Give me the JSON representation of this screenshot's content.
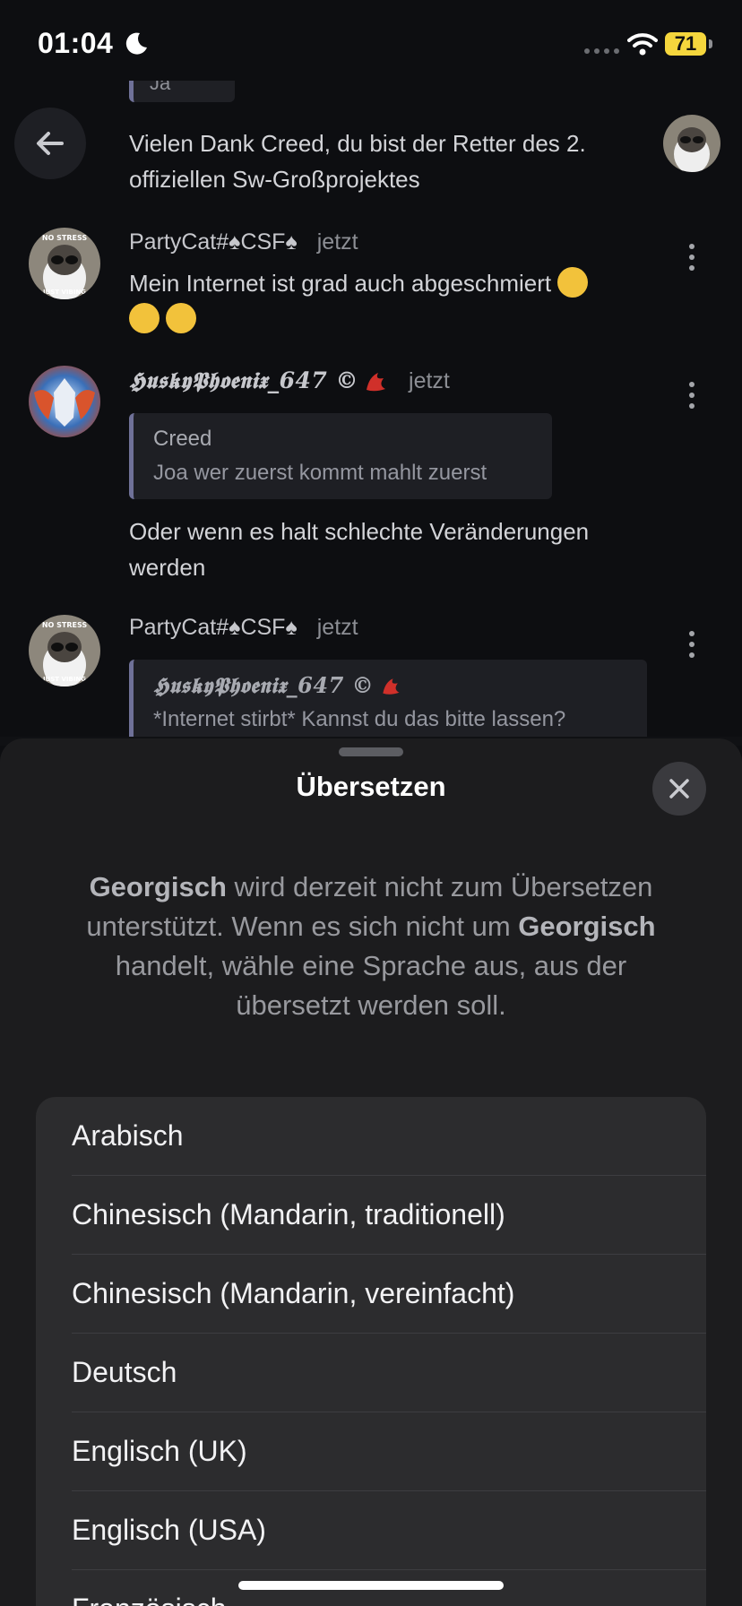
{
  "status_bar": {
    "time": "01:04",
    "battery": "71"
  },
  "chat": {
    "top_quote_text": "Ja",
    "messages": [
      {
        "text": "Vielen Dank Creed, du bist der Retter des 2. offiziellen Sw-Großprojektes"
      },
      {
        "author": "PartyCat#♠CSF♠",
        "time": "jetzt",
        "text": "Mein Internet ist grad auch abgeschmiert",
        "avatar_caption_top": "NO STRESS",
        "avatar_caption_bottom": "JUST VIBING"
      },
      {
        "author": "𝕳𝖚𝖘𝖐𝖞𝕻𝖍𝖔𝖊𝖓𝖎𝖝_647 ©",
        "time": "jetzt",
        "reply_author": "Creed",
        "reply_text": "Joa wer zuerst kommt mahlt zuerst",
        "text": "Oder wenn es halt schlechte Veränderungen werden"
      },
      {
        "author": "PartyCat#♠CSF♠",
        "time": "jetzt",
        "reply_author": "𝕳𝖚𝖘𝖐𝖞𝕻𝖍𝖔𝖊𝖓𝖎𝖝_647 ©",
        "reply_text": "*Internet stirbt* Kannst du das bitte lassen?",
        "avatar_caption_top": "NO STRESS",
        "avatar_caption_bottom": "JUST VIBING"
      }
    ]
  },
  "sheet": {
    "title": "Übersetzen",
    "desc": {
      "lang1": "Georgisch",
      "part1": " wird derzeit nicht zum Übersetzen unterstützt. Wenn es sich nicht um ",
      "lang2": "Georgisch",
      "part2": " handelt, wähle eine Sprache aus, aus der übersetzt werden soll."
    },
    "languages": [
      "Arabisch",
      "Chinesisch (Mandarin, traditionell)",
      "Chinesisch (Mandarin, vereinfacht)",
      "Deutsch",
      "Englisch (UK)",
      "Englisch (USA)",
      "Französisch"
    ]
  },
  "icons": {
    "back": "arrow-left-icon",
    "close": "close-icon",
    "more": "kebab-menu-icon",
    "status": [
      "moon-icon",
      "signal-icon",
      "wifi-icon",
      "battery-icon"
    ]
  },
  "colors": {
    "background": "#0d0e11",
    "sheet": "#1c1c1e",
    "list": "#2c2c2e",
    "quote_bar": "#6f7198",
    "battery": "#f5d63d"
  }
}
